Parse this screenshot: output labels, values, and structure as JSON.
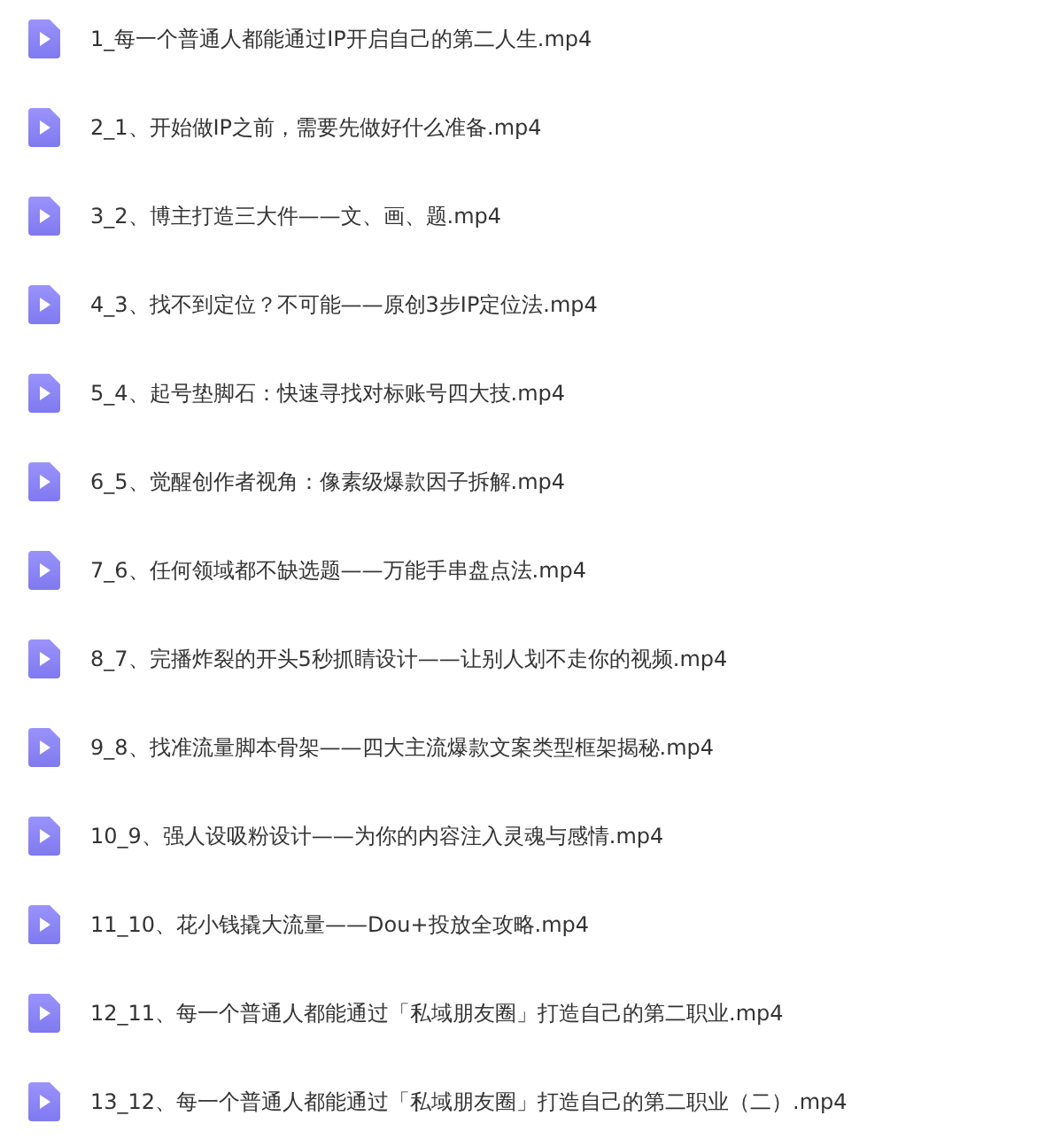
{
  "files": [
    {
      "name": "1_每一个普通人都能通过IP开启自己的第二人生.mp4"
    },
    {
      "name": "2_1、开始做IP之前，需要先做好什么准备.mp4"
    },
    {
      "name": "3_2、博主打造三大件——文、画、题.mp4"
    },
    {
      "name": "4_3、找不到定位？不可能——原创3步IP定位法.mp4"
    },
    {
      "name": "5_4、起号垫脚石：快速寻找对标账号四大技.mp4"
    },
    {
      "name": "6_5、觉醒创作者视角：像素级爆款因子拆解.mp4"
    },
    {
      "name": "7_6、任何领域都不缺选题——万能手串盘点法.mp4"
    },
    {
      "name": "8_7、完播炸裂的开头5秒抓睛设计——让别人划不走你的视频.mp4"
    },
    {
      "name": "9_8、找准流量脚本骨架——四大主流爆款文案类型框架揭秘.mp4"
    },
    {
      "name": "10_9、强人设吸粉设计——为你的内容注入灵魂与感情.mp4"
    },
    {
      "name": "11_10、花小钱撬大流量——Dou+投放全攻略.mp4"
    },
    {
      "name": "12_11、每一个普通人都能通过「私域朋友圈」打造自己的第二职业.mp4"
    },
    {
      "name": "13_12、每一个普通人都能通过「私域朋友圈」打造自己的第二职业（二）.mp4"
    }
  ]
}
